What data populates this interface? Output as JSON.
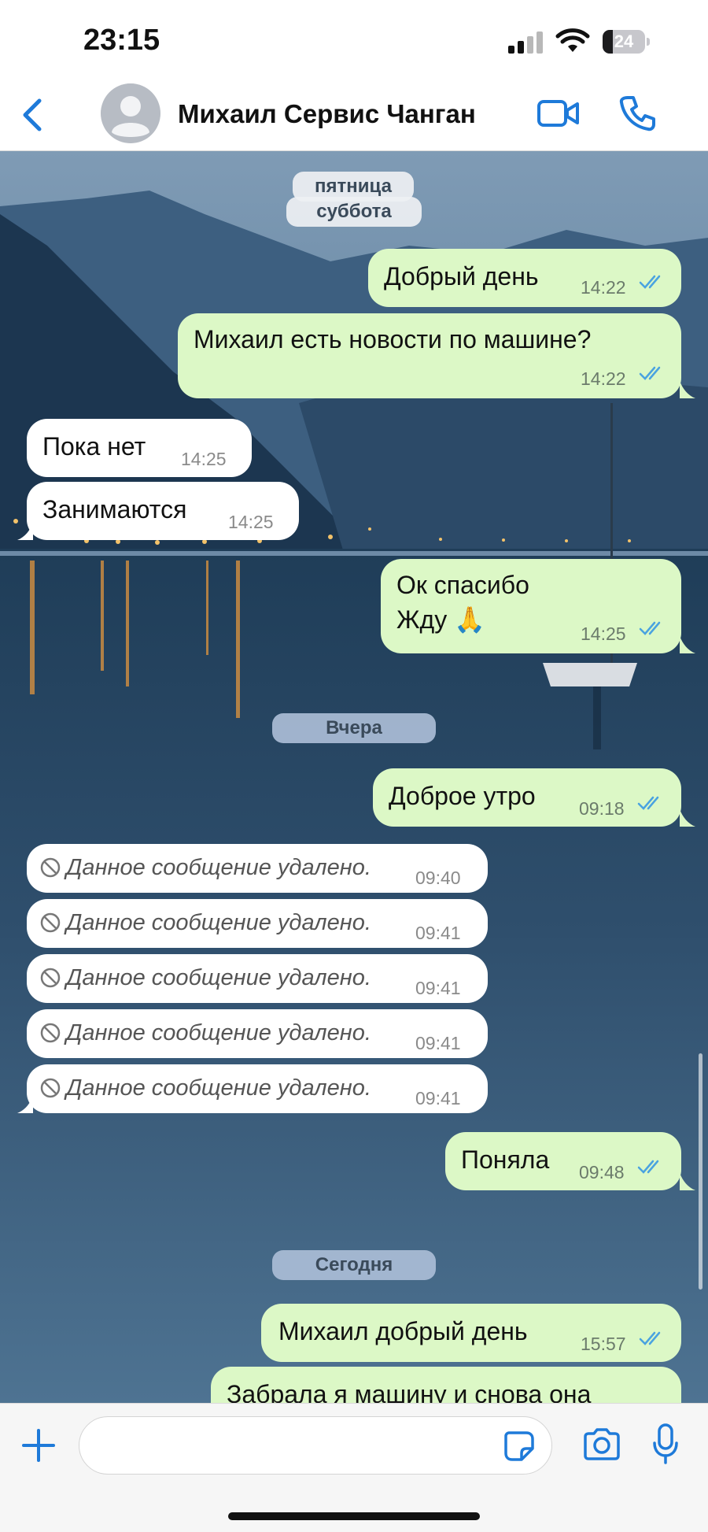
{
  "status_bar": {
    "time": "23:15",
    "battery_level": "24",
    "battery_fraction": 0.24
  },
  "header": {
    "contact_name": "Михаил Сервис Чанган",
    "icons": [
      "back-chevron",
      "avatar-placeholder",
      "video-camera",
      "phone"
    ]
  },
  "colors": {
    "accent": "#1e7ad9",
    "outgoing_bubble": "#dcf8c6",
    "incoming_bubble": "#ffffff",
    "read_ticks": "#4aa3e0"
  },
  "chat": {
    "dates": {
      "friday": "пятница",
      "saturday": "суббота",
      "yesterday": "Вчера",
      "today": "Сегодня"
    },
    "messages": [
      {
        "dir": "out",
        "text": "Добрый день",
        "time": "14:22",
        "read": true
      },
      {
        "dir": "out",
        "text": "Михаил есть новости по машине?",
        "time": "14:22",
        "read": true
      },
      {
        "dir": "in",
        "text": "Пока нет",
        "time": "14:25"
      },
      {
        "dir": "in",
        "text": "Занимаются",
        "time": "14:25"
      },
      {
        "dir": "out",
        "line1": "Ок спасибо",
        "line2": "Жду 🙏",
        "time": "14:25",
        "read": true
      },
      {
        "dir": "out",
        "text": "Доброе утро",
        "time": "09:18",
        "read": true
      },
      {
        "dir": "in",
        "deleted": true,
        "text": "Данное сообщение удалено.",
        "time": "09:40"
      },
      {
        "dir": "in",
        "deleted": true,
        "text": "Данное сообщение удалено.",
        "time": "09:41"
      },
      {
        "dir": "in",
        "deleted": true,
        "text": "Данное сообщение удалено.",
        "time": "09:41"
      },
      {
        "dir": "in",
        "deleted": true,
        "text": "Данное сообщение удалено.",
        "time": "09:41"
      },
      {
        "dir": "in",
        "deleted": true,
        "text": "Данное сообщение удалено.",
        "time": "09:41"
      },
      {
        "dir": "out",
        "text": "Поняла",
        "time": "09:48",
        "read": true
      },
      {
        "dir": "out",
        "text": "Михаил добрый день",
        "time": "15:57",
        "read": true
      },
      {
        "dir": "out",
        "text": "Забрала я машину и снова она",
        "partial": true
      }
    ]
  },
  "input_bar": {
    "placeholder": "",
    "icons": [
      "plus",
      "sticker",
      "camera",
      "microphone"
    ]
  }
}
